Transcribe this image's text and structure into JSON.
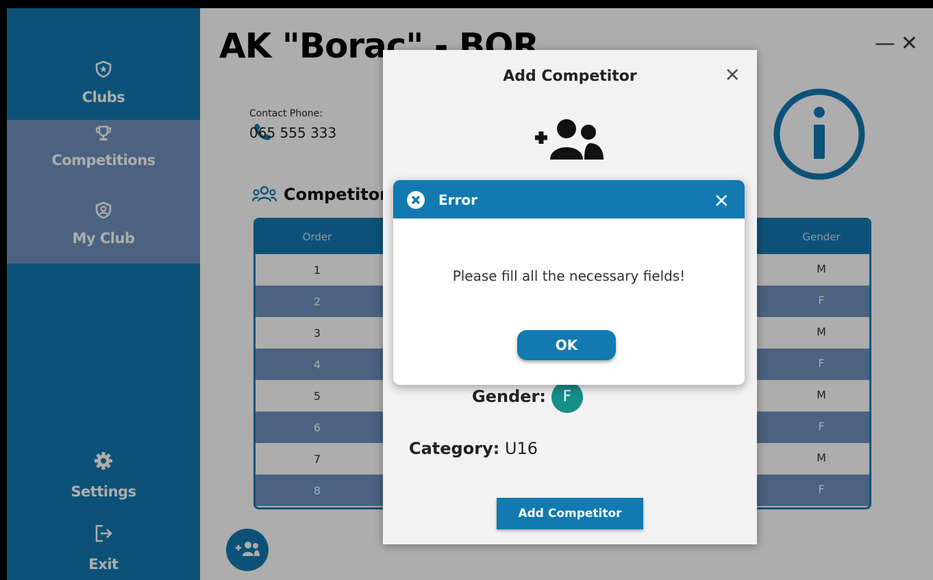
{
  "sidebar": {
    "items": [
      {
        "label": "Clubs",
        "icon": "shield-star-icon"
      },
      {
        "label": "Competitions",
        "icon": "trophy-icon"
      },
      {
        "label": "My Club",
        "icon": "shield-user-icon"
      },
      {
        "label": "Settings",
        "icon": "gear-icon"
      },
      {
        "label": "Exit",
        "icon": "exit-icon"
      }
    ]
  },
  "main": {
    "title": "AK \"Borac\" - BOR",
    "window_controls": {
      "minimize": "—",
      "close": "✕"
    },
    "contact": {
      "label": "Contact Phone:",
      "value": "065 555 333"
    },
    "competitors_heading": "Competitors",
    "table": {
      "headers": {
        "order": "Order",
        "gender": "Gender"
      },
      "rows": [
        {
          "order": "1",
          "gender": "M"
        },
        {
          "order": "2",
          "gender": "F"
        },
        {
          "order": "3",
          "gender": "M"
        },
        {
          "order": "4",
          "gender": "F"
        },
        {
          "order": "5",
          "gender": "M"
        },
        {
          "order": "6",
          "gender": "F"
        },
        {
          "order": "7",
          "gender": "M"
        },
        {
          "order": "8",
          "gender": "F"
        }
      ]
    }
  },
  "add_dialog": {
    "title": "Add Competitor",
    "close": "✕",
    "gender_label": "Gender:",
    "gender_value": "F",
    "category_label": "Category:",
    "category_value": "U16",
    "submit_label": "Add Competitor"
  },
  "error_dialog": {
    "title": "Error",
    "close": "✕",
    "message": "Please fill all the necessary fields!",
    "ok_label": "OK"
  },
  "colors": {
    "primary": "#1279b1",
    "sidebar_active": "#6f91bd",
    "gender_badge": "#168f8a"
  }
}
